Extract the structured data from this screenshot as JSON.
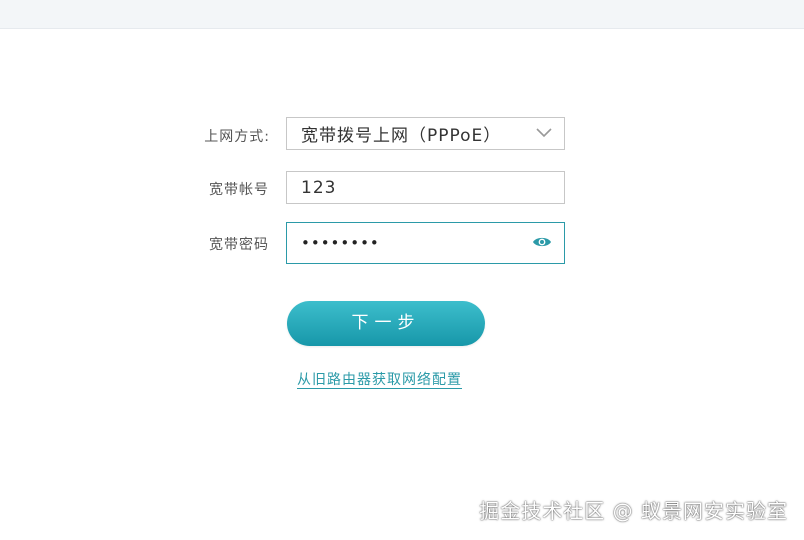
{
  "form": {
    "connection_type_label": "上网方式:",
    "connection_type_value": "宽带拨号上网（PPPoE）",
    "account_label": "宽带帐号",
    "account_value": "123",
    "password_label": "宽带密码",
    "password_masked": "••••••••",
    "next_button_label": "下一步",
    "old_router_link_label": "从旧路由器获取网络配置"
  },
  "watermark": {
    "text": "掘金技术社区 @ 蚁景网安实验室"
  },
  "icons": {
    "select_arrow": "chevron-down-icon",
    "password_toggle": "eye-icon"
  },
  "colors": {
    "accent": "#2b9aa8",
    "button_top": "#3dbecc",
    "button_bottom": "#1797a9",
    "topbar": "#f3f6f8"
  }
}
